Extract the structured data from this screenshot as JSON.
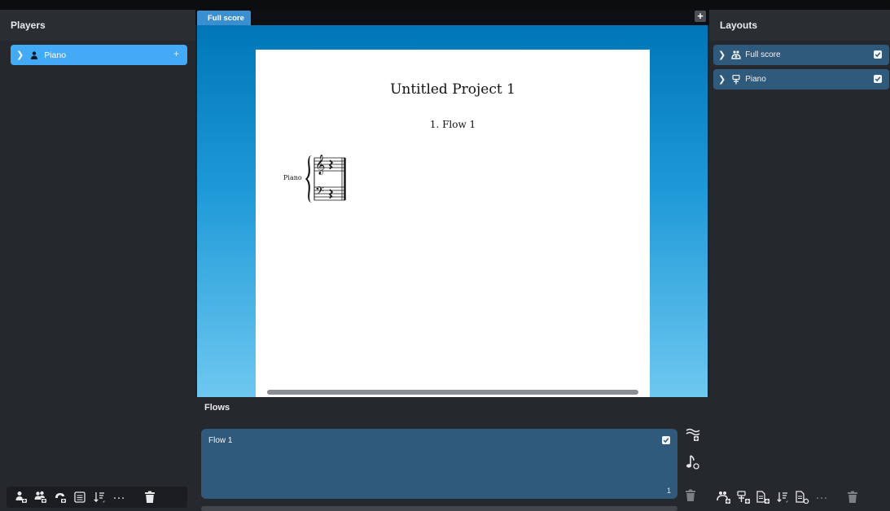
{
  "players_panel": {
    "title": "Players",
    "players": [
      {
        "name": "Piano"
      }
    ],
    "add_symbol": "+",
    "toolbar_icons": [
      "add-solo-player-icon",
      "add-ensemble-icon",
      "add-instrument-icon",
      "list-icon",
      "sort-icon",
      "more-icon",
      "delete-icon"
    ],
    "more_label": "···"
  },
  "center": {
    "tabs": [
      {
        "label": "Full score"
      }
    ],
    "add_tab_symbol": "+",
    "score": {
      "title": "Untitled Project 1",
      "flow_title": "1. Flow 1",
      "instrument_label": "Piano"
    }
  },
  "flows_panel": {
    "title": "Flows",
    "flows": [
      {
        "name": "Flow 1",
        "number": "1",
        "checked": true
      }
    ],
    "side_icons": [
      "add-flow-icon",
      "add-music-icon"
    ],
    "delete_icon": "delete-icon"
  },
  "layouts_panel": {
    "title": "Layouts",
    "layouts": [
      {
        "name": "Full score",
        "icon": "full-score-icon",
        "checked": true
      },
      {
        "name": "Piano",
        "icon": "part-icon",
        "checked": true
      }
    ],
    "toolbar_icons": [
      "add-full-score-layout-icon",
      "add-part-layout-icon",
      "add-custom-layout-icon",
      "sort-icon",
      "layout-options-icon",
      "more-icon",
      "delete-icon"
    ],
    "more_label": "···"
  },
  "colors": {
    "accent": "#43aaf7",
    "card": "#305a7c",
    "panel": "#25282d",
    "canvas_top": "#0076b7",
    "canvas_bottom": "#6ec8f0"
  }
}
